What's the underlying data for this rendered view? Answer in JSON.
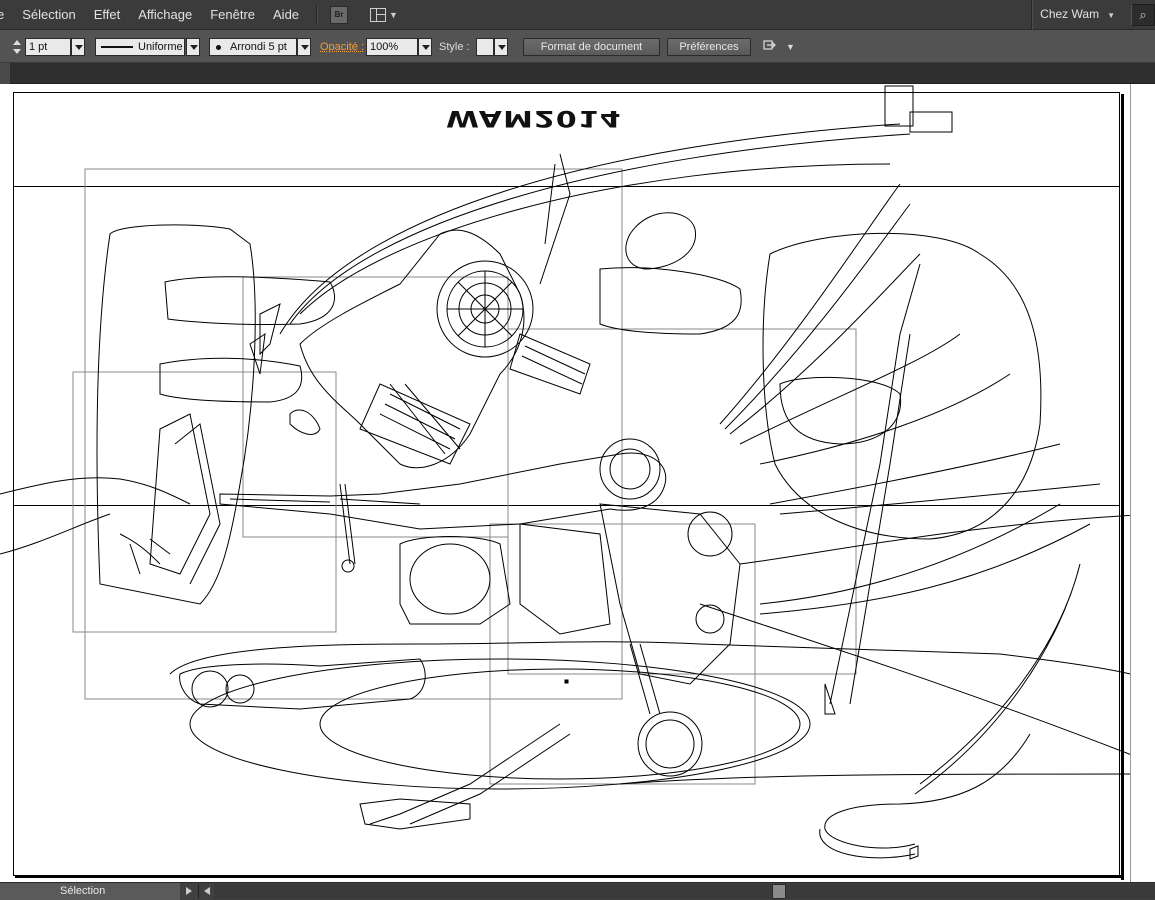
{
  "menubar": {
    "items": [
      "e",
      "Sélection",
      "Effet",
      "Affichage",
      "Fenêtre",
      "Aide"
    ],
    "bridge_label": "Br",
    "workspace": "Chez Wam",
    "icons": [
      "bridge-icon",
      "arrange-documents-icon",
      "search-icon"
    ]
  },
  "controlbar": {
    "stroke_weight": "1 pt",
    "stroke_profile": "Uniforme",
    "brush": "Arrondi 5 pt",
    "opacity_label": "Opacité :",
    "opacity_value": "100%",
    "style_label": "Style :",
    "doc_setup_button": "Format de document",
    "prefs_button": "Préférences"
  },
  "canvas": {
    "artwork_title": "WAM2014",
    "background": "#ffffff",
    "accent_orange": "#f5a033"
  },
  "statusbar": {
    "tool": "Sélection"
  }
}
